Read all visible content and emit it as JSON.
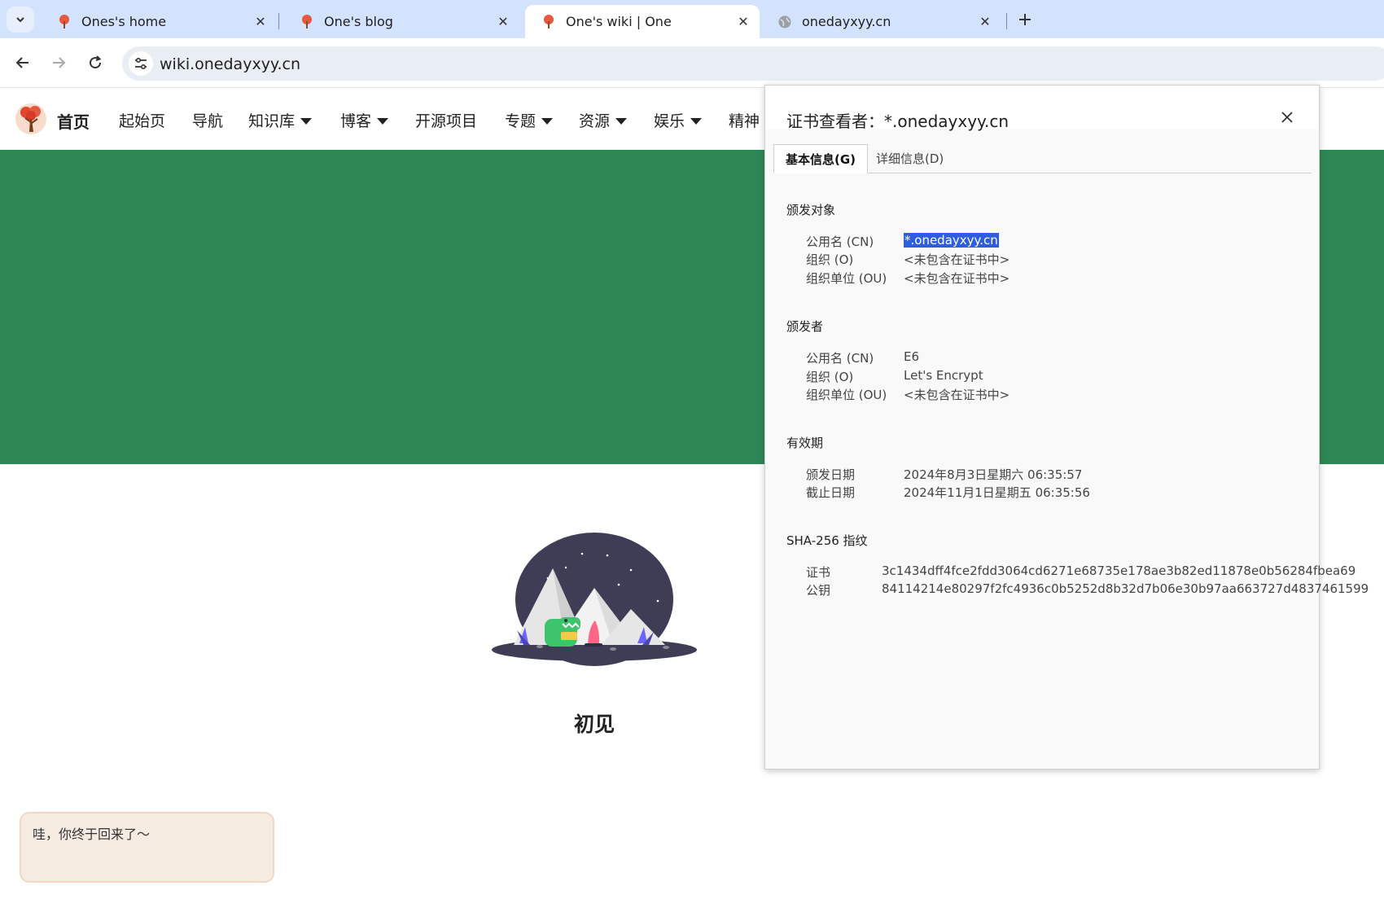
{
  "browser": {
    "tabs": [
      {
        "title": "Ones's home",
        "active": false
      },
      {
        "title": "One's blog",
        "active": false
      },
      {
        "title": "One's wiki | One",
        "active": true
      },
      {
        "title": "onedayxyy.cn",
        "active": false
      }
    ],
    "url": "wiki.onedayxyy.cn"
  },
  "site": {
    "home_label": "首页",
    "nav_items": [
      {
        "label": "起始页",
        "dropdown": false
      },
      {
        "label": "导航",
        "dropdown": false
      },
      {
        "label": "知识库",
        "dropdown": true
      },
      {
        "label": "博客",
        "dropdown": true
      },
      {
        "label": "开源项目",
        "dropdown": false
      },
      {
        "label": "专题",
        "dropdown": true
      },
      {
        "label": "资源",
        "dropdown": true
      },
      {
        "label": "娱乐",
        "dropdown": true
      },
      {
        "label": "精神",
        "dropdown": false
      }
    ],
    "hero_color": "#2e8856",
    "welcome_title": "初见",
    "chat_message": "哇，你终于回来了〜"
  },
  "certificate": {
    "title": "证书查看者：*.onedayxyy.cn",
    "tabs": [
      "基本信息(G)",
      "详细信息(D)"
    ],
    "issued_to": {
      "heading": "颁发对象",
      "fields": [
        {
          "label": "公用名 (CN)",
          "value": "*.onedayxyy.cn"
        },
        {
          "label": "组织 (O)",
          "value": "<未包含在证书中>"
        },
        {
          "label": "组织单位 (OU)",
          "value": "<未包含在证书中>"
        }
      ]
    },
    "issued_by": {
      "heading": "颁发者",
      "fields": [
        {
          "label": "公用名 (CN)",
          "value": "E6"
        },
        {
          "label": "组织 (O)",
          "value": "Let's Encrypt"
        },
        {
          "label": "组织单位 (OU)",
          "value": "<未包含在证书中>"
        }
      ]
    },
    "validity": {
      "heading": "有效期",
      "fields": [
        {
          "label": "颁发日期",
          "value": "2024年8月3日星期六 06:35:57"
        },
        {
          "label": "截止日期",
          "value": "2024年11月1日星期五 06:35:56"
        }
      ]
    },
    "fingerprints": {
      "heading": "SHA-256 指纹",
      "fields": [
        {
          "label": "证书",
          "value": "3c1434dff4fce2fdd3064cd6271e68735e178ae3b82ed11878e0b56284fbea69"
        },
        {
          "label": "公钥",
          "value": "84114214e80297f2fc4936c0b5252d8b32d7b06e30b97aa663727d4837461599"
        }
      ]
    }
  }
}
